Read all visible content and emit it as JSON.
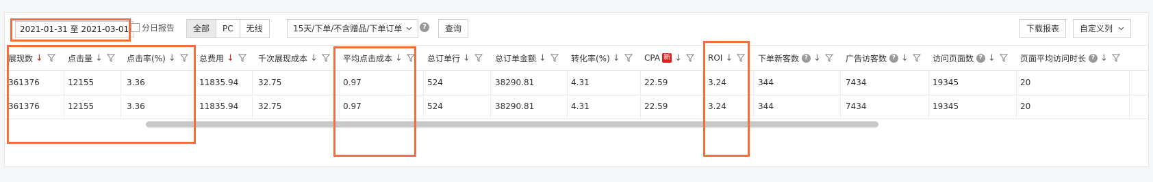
{
  "toolbar": {
    "date_range": "2021-01-31 至 2021-03-01",
    "daily_report_label": "分日报告",
    "segments": [
      "全部",
      "PC",
      "无线"
    ],
    "attribution_select": "15天/下单/不含赠品/下单订单",
    "query_label": "查询",
    "download_label": "下载报表",
    "custom_columns_label": "自定义列"
  },
  "table": {
    "columns": [
      "展现数",
      "点击量",
      "点击率(%)",
      "总费用",
      "千次展现成本",
      "平均点击成本",
      "总订单行",
      "总订单金额",
      "转化率(%)",
      "CPA",
      "ROI",
      "下单新客数",
      "广告访客数",
      "访问页面数",
      "页面平均访问时长"
    ],
    "new_badge": "新",
    "rows": [
      [
        "361376",
        "12155",
        "3.36",
        "11835.94",
        "32.75",
        "0.97",
        "524",
        "38290.81",
        "4.31",
        "22.59",
        "3.24",
        "344",
        "7434",
        "19345",
        "20"
      ],
      [
        "361376",
        "12155",
        "3.36",
        "11835.94",
        "32.75",
        "0.97",
        "524",
        "38290.81",
        "4.31",
        "22.59",
        "3.24",
        "344",
        "7434",
        "19345",
        "20"
      ]
    ]
  },
  "colors": {
    "highlight": "#f26c3c",
    "sort_active": "#e02020"
  },
  "icons": {
    "sort": "arrow-down-icon",
    "filter": "funnel-icon",
    "help": "question-circle-icon",
    "dropdown": "chevron-down-icon"
  }
}
